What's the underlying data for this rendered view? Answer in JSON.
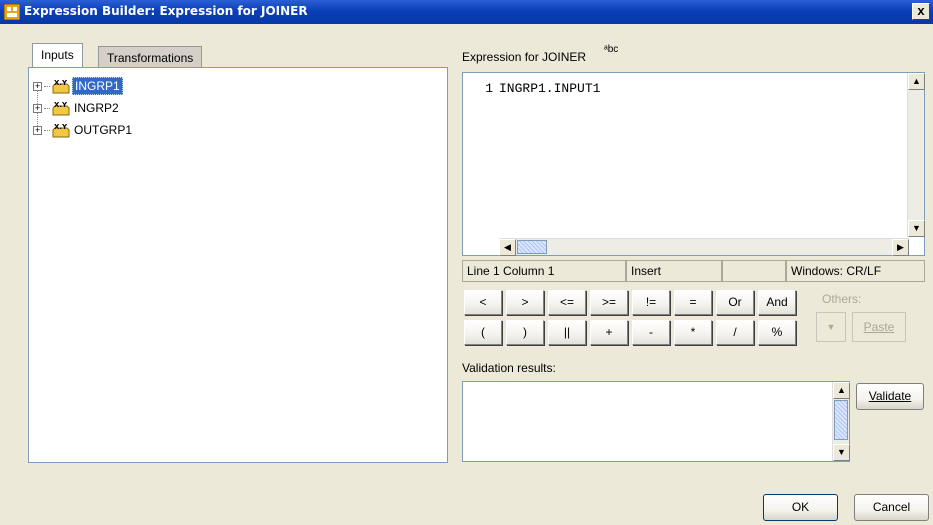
{
  "window": {
    "title": "Expression Builder: Expression for JOINER",
    "close_glyph": "x"
  },
  "tabs": [
    {
      "label": "Inputs",
      "active": true
    },
    {
      "label": "Transformations",
      "active": false
    }
  ],
  "tree": {
    "items": [
      {
        "label": "INGRP1",
        "selected": true,
        "expander": "+"
      },
      {
        "label": "INGRP2",
        "selected": false,
        "expander": "+"
      },
      {
        "label": "OUTGRP1",
        "selected": false,
        "expander": "+"
      }
    ],
    "icon_text": "X.Y"
  },
  "editor": {
    "label": "Expression for JOINER",
    "label_icon": "ᵃbc",
    "line_number": "1",
    "code": "INGRP1.INPUT1"
  },
  "status": {
    "position": "Line 1 Column 1",
    "mode": "Insert",
    "blank": "",
    "line_ending": "Windows: CR/LF"
  },
  "operators": {
    "row1": [
      "<",
      ">",
      "<=",
      ">=",
      "!=",
      "=",
      "Or",
      "And"
    ],
    "row2": [
      "(",
      ")",
      "||",
      "+",
      "-",
      "*",
      "/",
      "%"
    ]
  },
  "others": {
    "label": "Others:",
    "paste_label": "Paste",
    "dropdown_glyph": "▼"
  },
  "validation": {
    "label": "Validation results:",
    "validate_button": "Validate",
    "results_text": ""
  },
  "footer": {
    "ok": "OK",
    "cancel": "Cancel"
  },
  "colors": {
    "title_bar": "#0a3fb8",
    "selection": "#316ac5",
    "dialog_bg": "#ece9d8"
  }
}
